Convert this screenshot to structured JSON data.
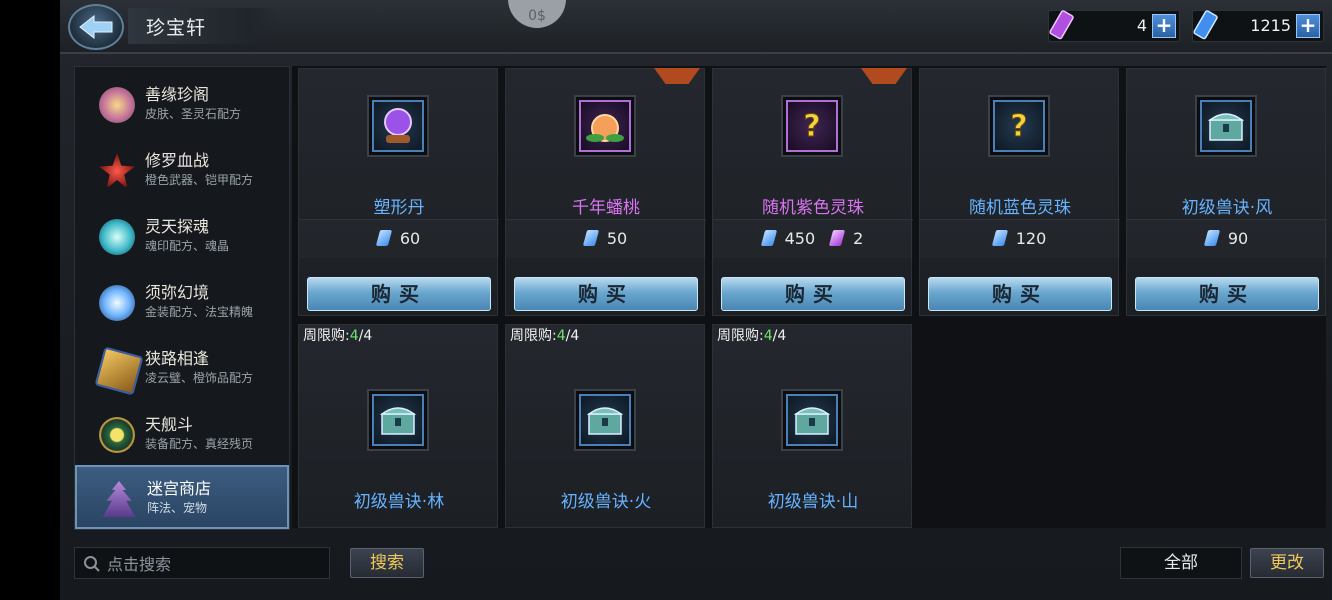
{
  "header": {
    "title": "珍宝轩",
    "top_coin": "0$",
    "currencies": [
      {
        "icon": "purple-ticket-icon",
        "value": "4"
      },
      {
        "icon": "blue-ticket-icon",
        "value": "1215"
      }
    ]
  },
  "sidebar": {
    "items": [
      {
        "name": "善缘珍阁",
        "sub": "皮肤、圣灵石配方",
        "icon": "lotus-icon"
      },
      {
        "name": "修罗血战",
        "sub": "橙色武器、铠甲配方",
        "icon": "red-star-icon"
      },
      {
        "name": "灵天探魂",
        "sub": "魂印配方、魂晶",
        "icon": "spirit-orb-icon"
      },
      {
        "name": "须弥幻境",
        "sub": "金装配方、法宝精魄",
        "icon": "blue-crystal-icon"
      },
      {
        "name": "狭路相逢",
        "sub": "凌云璧、橙饰品配方",
        "icon": "medal-icon"
      },
      {
        "name": "天舰斗",
        "sub": "装备配方、真经残页",
        "icon": "compass-icon"
      },
      {
        "name": "迷宫商店",
        "sub": "阵法、宠物",
        "icon": "pagoda-icon"
      }
    ]
  },
  "items": [
    {
      "name": "塑形丹",
      "price": "60",
      "icon": "purple-orb-icon",
      "rarity": "blue"
    },
    {
      "name": "千年蟠桃",
      "price": "50",
      "icon": "peach-icon",
      "rarity": "purple"
    },
    {
      "name": "随机紫色灵珠",
      "price": "450",
      "price2": "2",
      "icon": "question-mark-icon",
      "rarity": "purple"
    },
    {
      "name": "随机蓝色灵珠",
      "price": "120",
      "icon": "question-mark-icon",
      "rarity": "blue"
    },
    {
      "name": "初级兽诀·风",
      "price": "90",
      "icon": "treasure-chest-icon",
      "rarity": "blue"
    },
    {
      "name": "初级兽诀·林",
      "limit_label": "周限购:",
      "limit_cur": "4",
      "limit_max": "/4",
      "icon": "treasure-chest-icon",
      "rarity": "blue"
    },
    {
      "name": "初级兽诀·火",
      "limit_label": "周限购:",
      "limit_cur": "4",
      "limit_max": "/4",
      "icon": "treasure-chest-icon",
      "rarity": "blue"
    },
    {
      "name": "初级兽诀·山",
      "limit_label": "周限购:",
      "limit_cur": "4",
      "limit_max": "/4",
      "icon": "treasure-chest-icon",
      "rarity": "blue"
    }
  ],
  "buy_label": "购买",
  "footer": {
    "search_placeholder": "点击搜索",
    "search_button": "搜索",
    "filter_value": "全部",
    "change_button": "更改"
  },
  "colors": {
    "blue_rarity": "#66b3ff",
    "purple_rarity": "#d874f0",
    "limit_green": "#6ee56e"
  }
}
